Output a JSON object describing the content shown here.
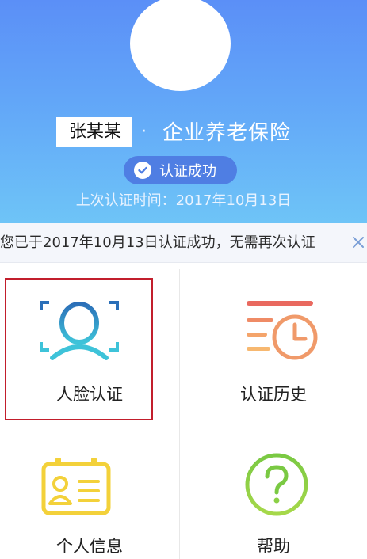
{
  "profile": {
    "name": "张某某",
    "separator": "·",
    "insurance_type": "企业养老保险",
    "status_label": "认证成功",
    "last_verify": "上次认证时间：2017年10月13日"
  },
  "notice": {
    "text": "您已于2017年10月13日认证成功，无需再次认证"
  },
  "menu": [
    {
      "label": "人脸认证",
      "icon": "face-scan-icon"
    },
    {
      "label": "认证历史",
      "icon": "history-clock-icon"
    },
    {
      "label": "个人信息",
      "icon": "id-card-icon"
    },
    {
      "label": "帮助",
      "icon": "help-question-icon"
    }
  ],
  "colors": {
    "header_top": "#5b8ff7",
    "header_bottom": "#6ec4f7",
    "badge": "#4f7ee3",
    "highlight_border": "#c21e2c"
  }
}
